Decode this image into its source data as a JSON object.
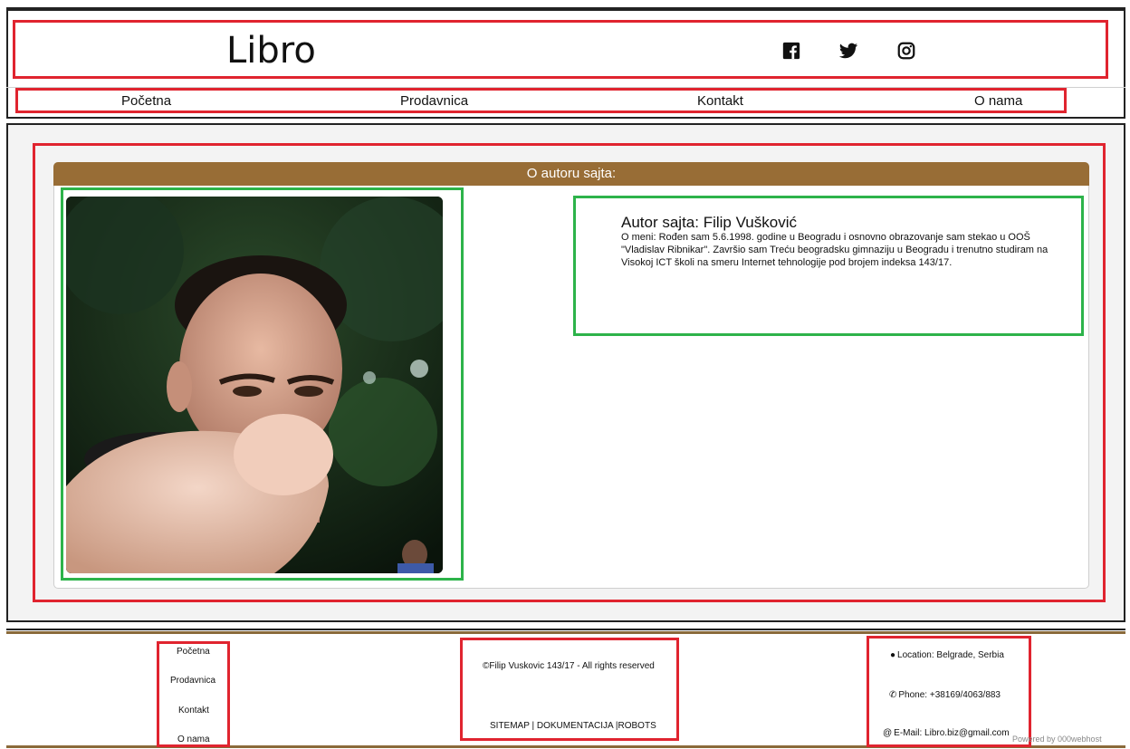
{
  "header": {
    "logo": "Libro",
    "social": [
      {
        "name": "facebook-icon"
      },
      {
        "name": "twitter-icon"
      },
      {
        "name": "instagram-icon"
      }
    ],
    "nav": [
      "Početna",
      "Prodavnica",
      "Kontakt",
      "O nama"
    ]
  },
  "main": {
    "card_title": "O autoru sajta:",
    "author_title": "Autor sajta: Filip Vušković",
    "author_bio": "O meni: Rođen sam 5.6.1998. godine u Beogradu i osnovno obrazovanje sam stekao u OOŠ \"Vladislav Ribnikar\". Završio sam Treću beogradsku gimnaziju u Beogradu i trenutno studiram na Visokoj ICT školi na smeru Internet tehnologije pod brojem indeksa 143/17."
  },
  "footer": {
    "nav": [
      "Početna",
      "Prodavnica",
      "Kontakt",
      "O nama"
    ],
    "copyright": "©Filip Vuskovic 143/17 - All rights reserved",
    "links": "SITEMAP | DOKUMENTACIJA |ROBOTS",
    "location": "Location: Belgrade, Serbia",
    "phone": "Phone: +38169/4063/883",
    "email": "E-Mail: Libro.biz@gmail.com",
    "powered": "Powered by  000webhost"
  },
  "colors": {
    "annotation_red": "#e0242f",
    "annotation_green": "#2db34a",
    "card_header": "#986d36"
  }
}
